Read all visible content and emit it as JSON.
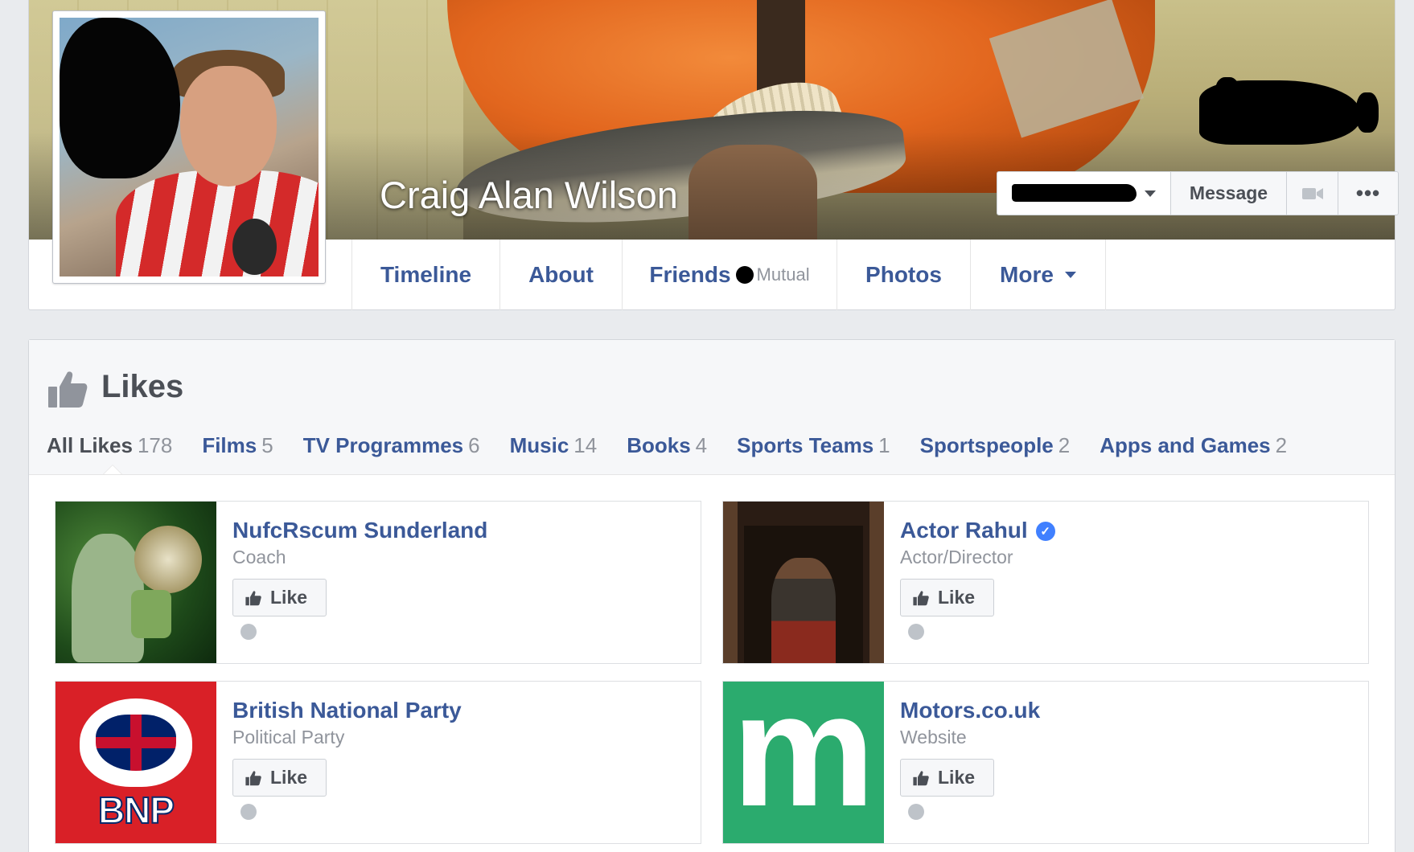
{
  "profile": {
    "name": "Craig Alan Wilson"
  },
  "actions": {
    "message_label": "Message",
    "more_label": "•••"
  },
  "nav": {
    "timeline": "Timeline",
    "about": "About",
    "friends": "Friends",
    "friends_sub": "Mutual",
    "photos": "Photos",
    "more": "More"
  },
  "likes": {
    "title": "Likes",
    "filters": [
      {
        "label": "All Likes",
        "count": "178"
      },
      {
        "label": "Films",
        "count": "5"
      },
      {
        "label": "TV Programmes",
        "count": "6"
      },
      {
        "label": "Music",
        "count": "14"
      },
      {
        "label": "Books",
        "count": "4"
      },
      {
        "label": "Sports Teams",
        "count": "1"
      },
      {
        "label": "Sportspeople",
        "count": "2"
      },
      {
        "label": "Apps and Games",
        "count": "2"
      }
    ],
    "items": [
      {
        "name": "NufcRscum Sunderland",
        "category": "Coach",
        "like_label": "Like"
      },
      {
        "name": "Actor Rahul",
        "category": "Actor/Director",
        "like_label": "Like",
        "verified": true
      },
      {
        "name": "British National Party",
        "category": "Political Party",
        "like_label": "Like",
        "logo_text": "BNP"
      },
      {
        "name": "Motors.co.uk",
        "category": "Website",
        "like_label": "Like",
        "logo_text": "m"
      }
    ]
  },
  "colors": {
    "link": "#3b5998",
    "muted": "#90949c",
    "bg": "#e9ebee",
    "motors_green": "#2bab6e",
    "bnp_red": "#d92027"
  }
}
